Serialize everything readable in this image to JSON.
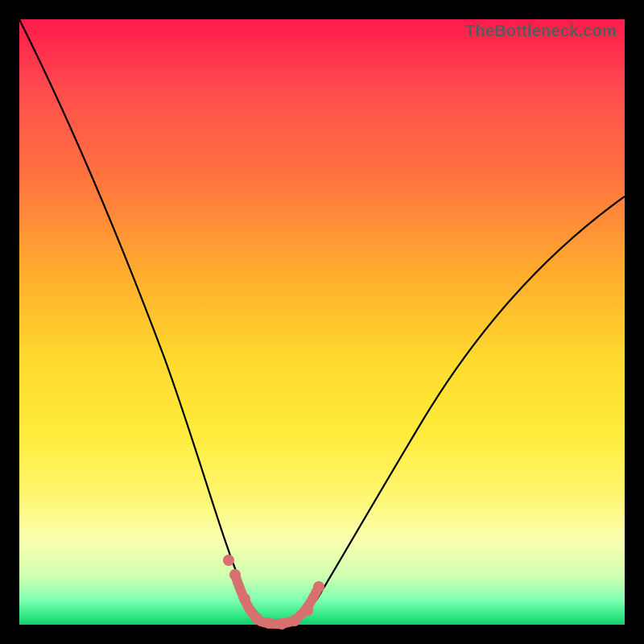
{
  "watermark": "TheBottleneck.com",
  "colors": {
    "background": "#000000",
    "curve": "#000000",
    "marker": "#d87070",
    "gradient_top": "#ff1a4c",
    "gradient_bottom": "#1cc96a"
  },
  "chart_data": {
    "type": "line",
    "title": "",
    "xlabel": "",
    "ylabel": "",
    "xlim": [
      0,
      100
    ],
    "ylim": [
      0,
      100
    ],
    "series": [
      {
        "name": "bottleneck-curve",
        "x": [
          0,
          5,
          10,
          15,
          20,
          25,
          30,
          32,
          34,
          36,
          38,
          40,
          42,
          44,
          46,
          50,
          55,
          60,
          65,
          70,
          75,
          80,
          85,
          90,
          95,
          100
        ],
        "values": [
          100,
          88,
          75,
          62,
          49,
          36,
          23,
          17,
          11,
          6,
          3,
          1,
          0,
          0,
          1,
          3,
          8,
          14,
          21,
          29,
          37,
          45,
          53,
          61,
          68,
          74
        ]
      }
    ],
    "markers": {
      "name": "highlight-minimum",
      "x": [
        34,
        36,
        38,
        40,
        42,
        44,
        46,
        48
      ],
      "values": [
        11,
        6,
        3,
        1,
        0,
        0,
        1,
        3
      ]
    },
    "annotations": []
  }
}
